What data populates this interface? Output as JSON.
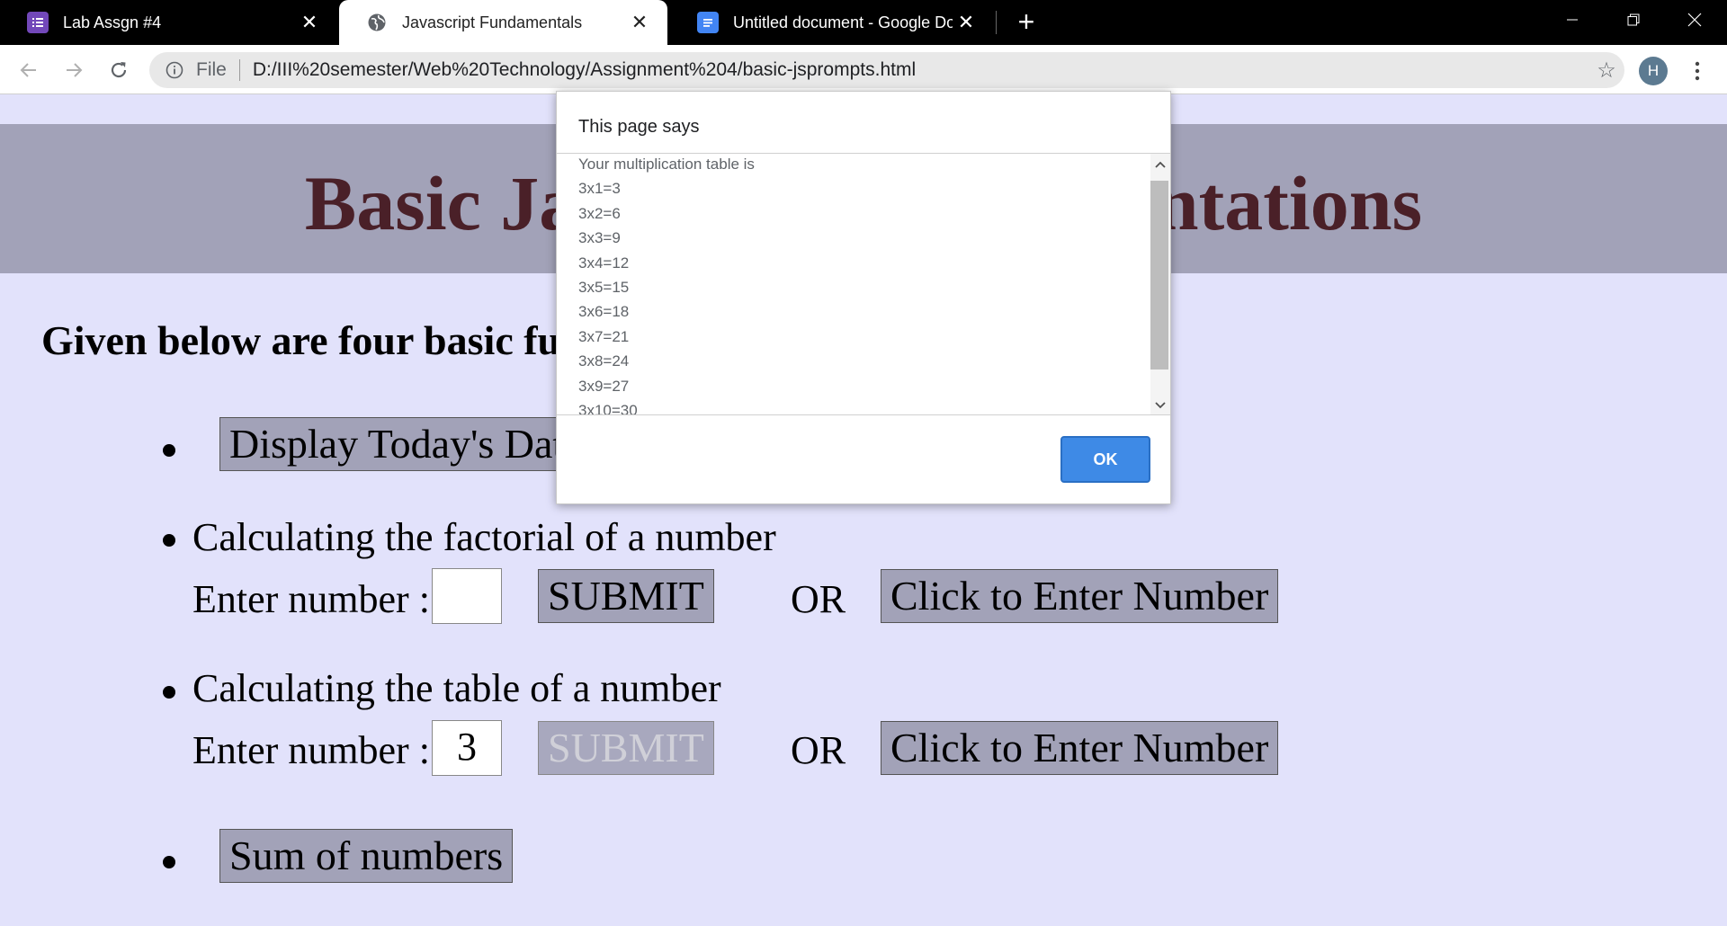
{
  "browser": {
    "tabs": [
      {
        "title": "Lab Assgn #4",
        "icon": "forms-icon",
        "color": "#7248b9"
      },
      {
        "title": "Javascript Fundamentals",
        "icon": "globe-icon",
        "active": true
      },
      {
        "title": "Untitled document - Google Docs",
        "icon": "docs-icon",
        "color": "#4285f4"
      }
    ],
    "new_tab": "+",
    "address": {
      "scheme": "File",
      "url": "D:/III%20semester/Web%20Technology/Assignment%204/basic-jsprompts.html"
    },
    "profile_initial": "H"
  },
  "page": {
    "banner_title": "Basic Javascript Implementations",
    "intro": "Given below are four basic functions",
    "items": {
      "date_button": "Display Today's Date",
      "factorial_heading": "Calculating the factorial of a number",
      "factorial_label": "Enter number :",
      "factorial_value": "",
      "factorial_submit": "SUBMIT",
      "factorial_or": "OR",
      "factorial_prompt_button": "Click to Enter Number",
      "table_heading": "Calculating the table of a number",
      "table_label": "Enter number :",
      "table_value": "3",
      "table_submit": "SUBMIT",
      "table_or": "OR",
      "table_prompt_button": "Click to Enter Number",
      "sum_button": "Sum of numbers"
    }
  },
  "dialog": {
    "title": "This page says",
    "lines": [
      "Your multiplication table is",
      "3x1=3",
      "3x2=6",
      "3x3=9",
      "3x4=12",
      "3x5=15",
      "3x6=18",
      "3x7=21",
      "3x8=24",
      "3x9=27",
      "3x10=30"
    ],
    "ok_label": "OK"
  }
}
